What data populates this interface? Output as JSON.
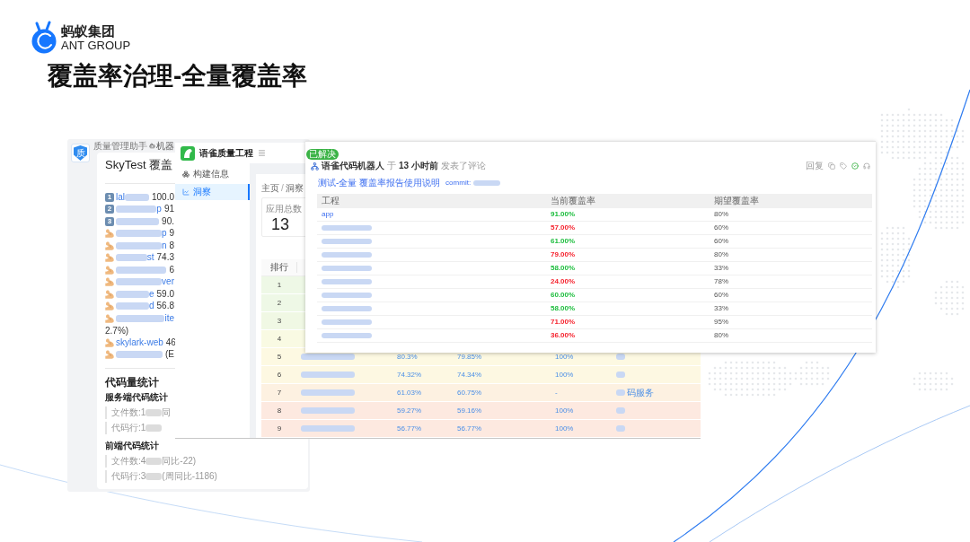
{
  "logo": {
    "name_cn": "蚂蚁集团",
    "name_en": "ANT GROUP"
  },
  "title": "覆盖率治理-全量覆盖率",
  "chat_panel": {
    "avatar": "质",
    "app_name": "质量管理助手",
    "robot_label": "机器",
    "card_title": "SkyTest 覆盖",
    "ranking": [
      {
        "kind": "badge",
        "rank": "1",
        "link_head": "lal",
        "redacted": true,
        "value": "100.0"
      },
      {
        "kind": "badge",
        "rank": "2",
        "redacted": true,
        "link_tail": "p",
        "value": "91"
      },
      {
        "kind": "badge",
        "rank": "3",
        "redacted": true,
        "value": "90."
      },
      {
        "kind": "emoji",
        "redacted": true,
        "link_tail": "p",
        "value": "9"
      },
      {
        "kind": "emoji",
        "redacted": true,
        "link_tail": "n",
        "value": "8"
      },
      {
        "kind": "emoji",
        "redacted": true,
        "link_tail": "st",
        "value": "74.3"
      },
      {
        "kind": "emoji",
        "redacted": true,
        "value": "6"
      },
      {
        "kind": "emoji",
        "redacted": true,
        "link_tail": "ver"
      },
      {
        "kind": "emoji",
        "redacted": true,
        "link_tail": "e",
        "value": "59.0"
      },
      {
        "kind": "emoji",
        "redacted": true,
        "link_tail": "d",
        "value": "56.8"
      },
      {
        "kind": "emoji",
        "redacted": true,
        "link_tail": "ite"
      },
      {
        "kind": "continuation",
        "value": "2.7%)"
      },
      {
        "kind": "emoji",
        "link_head": "skylark-web",
        "redacted": false,
        "value": "46"
      },
      {
        "kind": "emoji",
        "redacted": true,
        "value": "(E"
      }
    ],
    "code_stats": {
      "title": "代码量统计",
      "sections": [
        {
          "title": "服务端代码统计",
          "lines": [
            {
              "head": "文件数:1",
              "redacted": true,
              "tail": "同"
            },
            {
              "head": "代码行:1",
              "redacted": true
            }
          ]
        },
        {
          "title": "前端代码统计",
          "lines": [
            {
              "head": "文件数:4",
              "redacted": true,
              "tail": "同比-22)"
            },
            {
              "head": "代码行:3",
              "redacted": true,
              "tail": "(周同比-1186)"
            }
          ]
        }
      ]
    }
  },
  "quality_app": {
    "app_title": "语雀质量工程",
    "nav": [
      {
        "label": "构建信息",
        "selected": false
      },
      {
        "label": "洞察",
        "selected": true
      }
    ],
    "breadcrumb": {
      "items": [
        "主页",
        "洞察"
      ],
      "separator": "/"
    },
    "stat": {
      "label": "应用总数",
      "value": "13"
    },
    "table": {
      "columns": [
        "排行"
      ],
      "rows": [
        {
          "rank": "1",
          "color": "#eef8e6"
        },
        {
          "rank": "2",
          "color": "#eef8e6"
        },
        {
          "rank": "3",
          "color": "#f0f8e4"
        },
        {
          "rank": "4",
          "color": "#f9fae3"
        },
        {
          "rank": "5",
          "color": "#fdf9e2",
          "redacted": true,
          "column_3": "80.3%",
          "column_4": "79.85%",
          "column_5": "100%"
        },
        {
          "rank": "6",
          "color": "#fdf8e2",
          "redacted": true,
          "column_3": "74.32%",
          "column_4": "74.34%",
          "column_5": "100%"
        },
        {
          "rank": "7",
          "color": "#fdf1e1",
          "redacted": true,
          "column_3": "61.03%",
          "column_4": "60.75%",
          "column_5": "-",
          "column_6": "码服务"
        },
        {
          "rank": "8",
          "color": "#fde9e0",
          "redacted": true,
          "column_3": "59.27%",
          "column_4": "59.16%",
          "column_5": "100%"
        },
        {
          "rank": "9",
          "color": "#fde9e0",
          "redacted": true,
          "column_3": "56.77%",
          "column_4": "56.77%",
          "column_5": "100%"
        }
      ]
    }
  },
  "comment": {
    "status_tag": "已解决",
    "author": "语雀代码机器人",
    "preposition": "于",
    "time": "13 小时前",
    "action": "发表了评论",
    "reply": "回复",
    "doc_link": "测试-全量 覆盖率报告使用说明",
    "commit_label": "commit:",
    "commit_redacted": true,
    "table": {
      "columns": [
        "工程",
        "当前覆盖率",
        "期望覆盖率"
      ],
      "rows": [
        {
          "project": "app",
          "redacted": false,
          "current": "91.00%",
          "color": "#1cbd3d",
          "expected": "80%"
        },
        {
          "redacted": true,
          "current": "57.00%",
          "color": "#f5222d",
          "expected": "60%"
        },
        {
          "redacted": true,
          "current": "61.00%",
          "color": "#1cbd3d",
          "expected": "60%"
        },
        {
          "redacted": true,
          "current": "79.00%",
          "color": "#f5222d",
          "expected": "80%"
        },
        {
          "redacted": true,
          "current": "58.00%",
          "color": "#1cbd3d",
          "expected": "33%"
        },
        {
          "redacted": true,
          "current": "24.00%",
          "color": "#f5222d",
          "expected": "78%"
        },
        {
          "redacted": true,
          "current": "60.00%",
          "color": "#1cbd3d",
          "expected": "60%"
        },
        {
          "redacted": true,
          "current": "58.00%",
          "color": "#1cbd3d",
          "expected": "33%"
        },
        {
          "redacted": true,
          "current": "71.00%",
          "color": "#f5222d",
          "expected": "95%"
        },
        {
          "redacted": true,
          "current": "36.00%",
          "color": "#f5222d",
          "expected": "80%"
        }
      ]
    }
  }
}
